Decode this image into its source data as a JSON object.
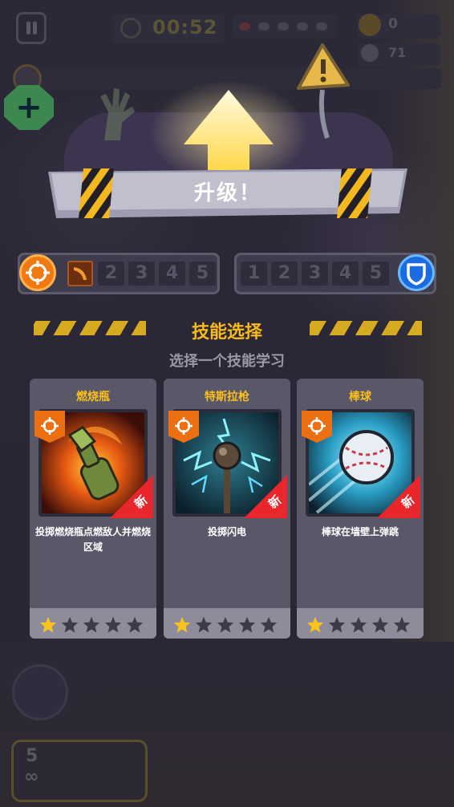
{
  "hud": {
    "timer": "00:52",
    "coins": "0",
    "kills": "71",
    "add_label": "+"
  },
  "banner": {
    "title": "升级！"
  },
  "weapon_slots": {
    "numbers": [
      "2",
      "3",
      "4",
      "5"
    ]
  },
  "passive_slots": {
    "numbers": [
      "1",
      "2",
      "3",
      "4",
      "5"
    ]
  },
  "skill_select": {
    "title": "技能选择",
    "subtitle": "选择一个技能学习"
  },
  "cards": [
    {
      "name": "燃烧瓶",
      "description": "投掷燃烧瓶点燃敌人并燃烧区域",
      "badge": "新",
      "stars_filled": 1,
      "stars_total": 5
    },
    {
      "name": "特斯拉枪",
      "description": "投掷闪电",
      "badge": "新",
      "stars_filled": 1,
      "stars_total": 5
    },
    {
      "name": "棒球",
      "description": "棒球在墙壁上弹跳",
      "badge": "新",
      "stars_filled": 1,
      "stars_total": 5
    }
  ],
  "bottom": {
    "ammo": "5",
    "infinite": "∞"
  },
  "colors": {
    "accent": "#f6ba1c",
    "new_ribbon": "#e8262c",
    "target_badge": "#ec6f12",
    "passive_badge": "#1b6ce2",
    "card_bg": "#5a5868"
  }
}
